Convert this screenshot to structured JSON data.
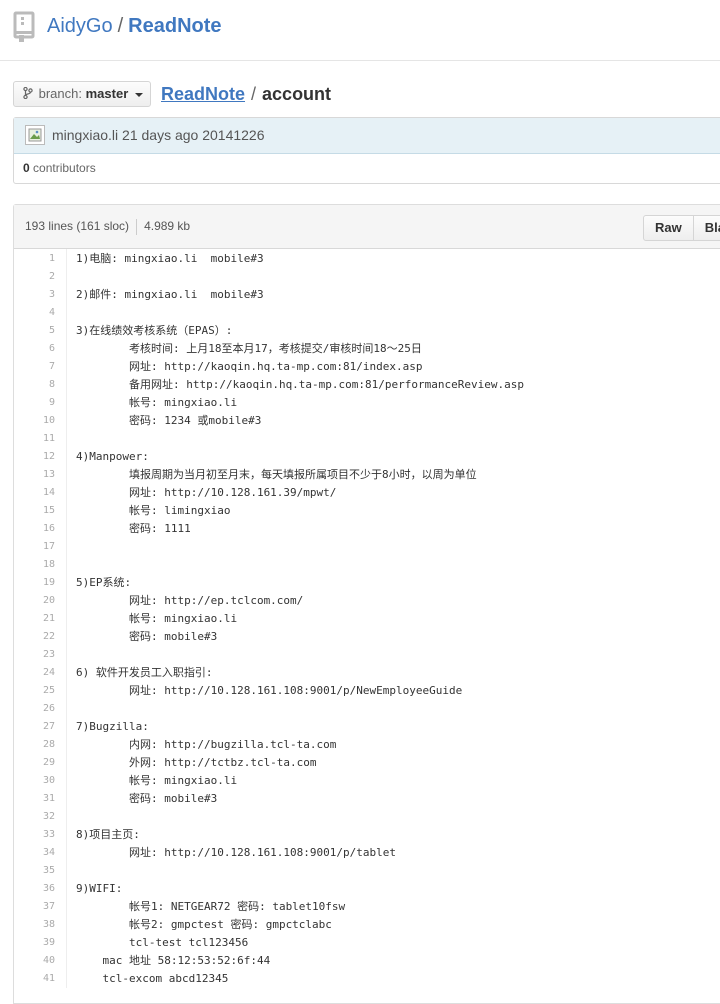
{
  "repo": {
    "owner": "AidyGo",
    "separator": "/",
    "name": "ReadNote"
  },
  "branch": {
    "label": "branch:",
    "value": "master"
  },
  "breadcrumb": {
    "root": "ReadNote",
    "separator": "/",
    "file": "account"
  },
  "commit": {
    "author": "mingxiao.li",
    "time": "21 days ago",
    "message": "20141226"
  },
  "contributors": {
    "count": "0",
    "label": "contributors"
  },
  "file": {
    "lines": "193 lines (161 sloc)",
    "size": "4.989 kb",
    "raw_label": "Raw",
    "blame_label": "Bla"
  },
  "code": [
    {
      "n": "1",
      "text": "1)电脑: mingxiao.li  mobile#3"
    },
    {
      "n": "2",
      "text": ""
    },
    {
      "n": "3",
      "text": "2)邮件: mingxiao.li  mobile#3"
    },
    {
      "n": "4",
      "text": ""
    },
    {
      "n": "5",
      "text": "3)在线绩效考核系统（EPAS）:"
    },
    {
      "n": "6",
      "text": "        考核时间: 上月18至本月17，考核提交/审核时间18～25日"
    },
    {
      "n": "7",
      "text": "        网址: http://kaoqin.hq.ta-mp.com:81/index.asp"
    },
    {
      "n": "8",
      "text": "        备用网址: http://kaoqin.hq.ta-mp.com:81/performanceReview.asp"
    },
    {
      "n": "9",
      "text": "        帐号: mingxiao.li"
    },
    {
      "n": "10",
      "text": "        密码: 1234 或mobile#3"
    },
    {
      "n": "11",
      "text": ""
    },
    {
      "n": "12",
      "text": "4)Manpower:"
    },
    {
      "n": "13",
      "text": "        填报周期为当月初至月末，每天填报所属项目不少于8小时，以周为单位"
    },
    {
      "n": "14",
      "text": "        网址: http://10.128.161.39/mpwt/"
    },
    {
      "n": "15",
      "text": "        帐号: limingxiao"
    },
    {
      "n": "16",
      "text": "        密码: 1111"
    },
    {
      "n": "17",
      "text": ""
    },
    {
      "n": "18",
      "text": ""
    },
    {
      "n": "19",
      "text": "5)EP系统:"
    },
    {
      "n": "20",
      "text": "        网址: http://ep.tclcom.com/"
    },
    {
      "n": "21",
      "text": "        帐号: mingxiao.li"
    },
    {
      "n": "22",
      "text": "        密码: mobile#3"
    },
    {
      "n": "23",
      "text": ""
    },
    {
      "n": "24",
      "text": "6) 软件开发员工入职指引:"
    },
    {
      "n": "25",
      "text": "        网址: http://10.128.161.108:9001/p/NewEmployeeGuide"
    },
    {
      "n": "26",
      "text": ""
    },
    {
      "n": "27",
      "text": "7)Bugzilla:"
    },
    {
      "n": "28",
      "text": "        内网: http://bugzilla.tcl-ta.com"
    },
    {
      "n": "29",
      "text": "        外网: http://tctbz.tcl-ta.com"
    },
    {
      "n": "30",
      "text": "        帐号: mingxiao.li"
    },
    {
      "n": "31",
      "text": "        密码: mobile#3"
    },
    {
      "n": "32",
      "text": ""
    },
    {
      "n": "33",
      "text": "8)项目主页:"
    },
    {
      "n": "34",
      "text": "        网址: http://10.128.161.108:9001/p/tablet"
    },
    {
      "n": "35",
      "text": ""
    },
    {
      "n": "36",
      "text": "9)WIFI:"
    },
    {
      "n": "37",
      "text": "        帐号1: NETGEAR72 密码: tablet10fsw"
    },
    {
      "n": "38",
      "text": "        帐号2: gmpctest 密码: gmpctclabc"
    },
    {
      "n": "39",
      "text": "        tcl-test tcl123456"
    },
    {
      "n": "40",
      "text": "    mac 地址 58:12:53:52:6f:44"
    },
    {
      "n": "41",
      "text": "    tcl-excom abcd12345"
    }
  ]
}
